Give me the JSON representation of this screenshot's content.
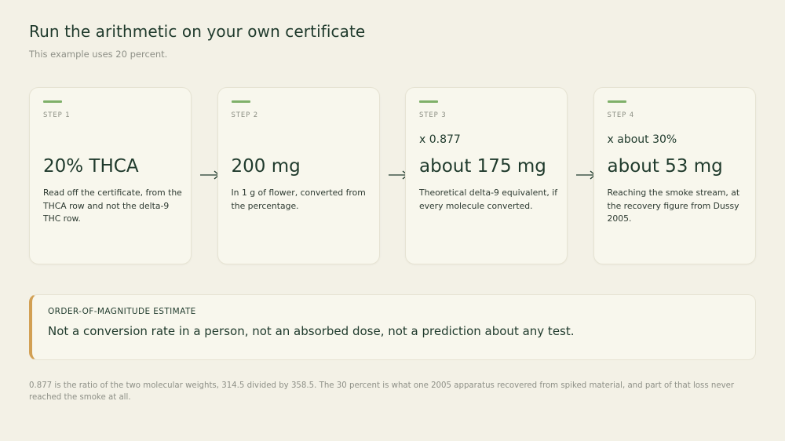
{
  "header": {
    "title": "Run the arithmetic on your own certificate",
    "subtitle": "This example uses 20 percent."
  },
  "steps": [
    {
      "label": "STEP 1",
      "multiplier": "",
      "value": "20% THCA",
      "description": "Read off the certificate, from the THCA row and not the delta-9 THC row."
    },
    {
      "label": "STEP 2",
      "multiplier": "",
      "value": "200 mg",
      "description": "In 1 g of flower, converted from the percentage."
    },
    {
      "label": "STEP 3",
      "multiplier": "x 0.877",
      "value": "about 175 mg",
      "description": "Theoretical delta-9 equivalent, if every molecule converted."
    },
    {
      "label": "STEP 4",
      "multiplier": "x about 30%",
      "value": "about 53 mg",
      "description": "Reaching the smoke stream, at the recovery figure from Dussy 2005."
    }
  ],
  "callout": {
    "label": "ORDER-OF-MAGNITUDE ESTIMATE",
    "text": "Not a conversion rate in a person, not an absorbed dose, not a prediction about any test."
  },
  "footnote": "0.877 is the ratio of the two molecular weights, 314.5 divided by 358.5. The 30 percent is what one 2005 apparatus recovered from spiked material, and part of that loss never reached the smoke at all.",
  "colors": {
    "background": "#f3f1e6",
    "card": "#f8f7ed",
    "accent_green": "#7fb069",
    "accent_amber": "#d2a054",
    "text_dark": "#1f3a2c",
    "text_muted": "#8e9087"
  },
  "icons": {
    "arrow": "arrow-right-icon"
  }
}
